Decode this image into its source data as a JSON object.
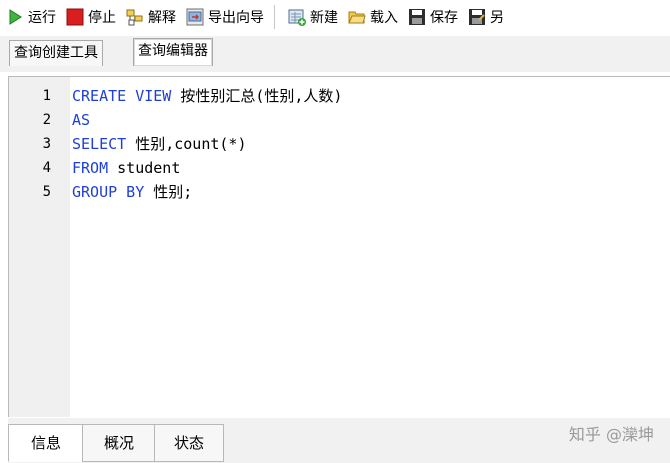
{
  "toolbar": {
    "run": "运行",
    "stop": "停止",
    "explain": "解释",
    "export_wizard": "导出向导",
    "new": "新建",
    "load": "载入",
    "save": "保存",
    "save_as_partial": "另"
  },
  "tabs": [
    "查询创建工具",
    "查询编辑器"
  ],
  "active_tab": "查询编辑器",
  "editor": {
    "line_numbers": [
      "1",
      "2",
      "3",
      "4",
      "5"
    ],
    "lines": [
      [
        {
          "t": "CREATE VIEW",
          "kw": true
        },
        {
          "t": " 按性别汇总(性别,人数)",
          "kw": false
        }
      ],
      [
        {
          "t": "AS",
          "kw": true
        }
      ],
      [
        {
          "t": "SELECT",
          "kw": true
        },
        {
          "t": " 性别,count(*)",
          "kw": false
        }
      ],
      [
        {
          "t": "FROM",
          "kw": true
        },
        {
          "t": " student",
          "kw": false
        }
      ],
      [
        {
          "t": "GROUP BY",
          "kw": true
        },
        {
          "t": " 性别;",
          "kw": false
        }
      ]
    ],
    "keyword_color": "#1f3fd6"
  },
  "bottom_tabs": [
    "信息",
    "概况",
    "状态"
  ],
  "active_bottom_tab": "信息",
  "watermark": "知乎 @灤坤",
  "icons": {
    "run": "play-icon",
    "stop": "stop-icon",
    "explain": "explain-icon",
    "export_wizard": "export-wizard-icon",
    "new": "new-query-icon",
    "load": "folder-open-icon",
    "save": "save-icon",
    "save_as": "save-as-icon"
  }
}
